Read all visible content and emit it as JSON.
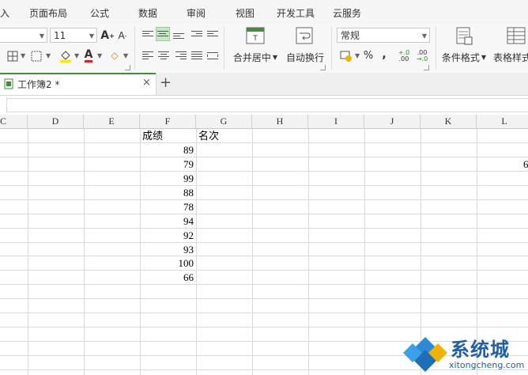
{
  "menu": [
    "入",
    "页面布局",
    "公式",
    "数据",
    "审阅",
    "视图",
    "开发工具",
    "云服务"
  ],
  "ribbon": {
    "font_size": "11",
    "number_format": "常规",
    "merge_center": "合并居中",
    "wrap_text": "自动换行",
    "conditional_format": "条件格式",
    "table_style": "表格样式",
    "percent": "%",
    "comma": "❟",
    "increase_decimal": "+.0\n.00",
    "decrease_decimal": ".00\n→.0"
  },
  "doc_tab": {
    "name": "工作簿2 *",
    "close": "×",
    "add": "+"
  },
  "columns": [
    "C",
    "D",
    "E",
    "F",
    "G",
    "H",
    "I",
    "J",
    "K",
    "L"
  ],
  "sheet": {
    "header_f": "成绩",
    "header_g": "名次",
    "scores": [
      "89",
      "79",
      "99",
      "88",
      "78",
      "94",
      "92",
      "93",
      "100",
      "66"
    ],
    "partial_value_l": "6"
  },
  "watermark": {
    "title": "系统城",
    "url": "xitongcheng.com"
  },
  "colors": {
    "accent_green": "#3f8f3a",
    "menu_bg": "#f5f5f5",
    "grid_line": "#dadada"
  }
}
